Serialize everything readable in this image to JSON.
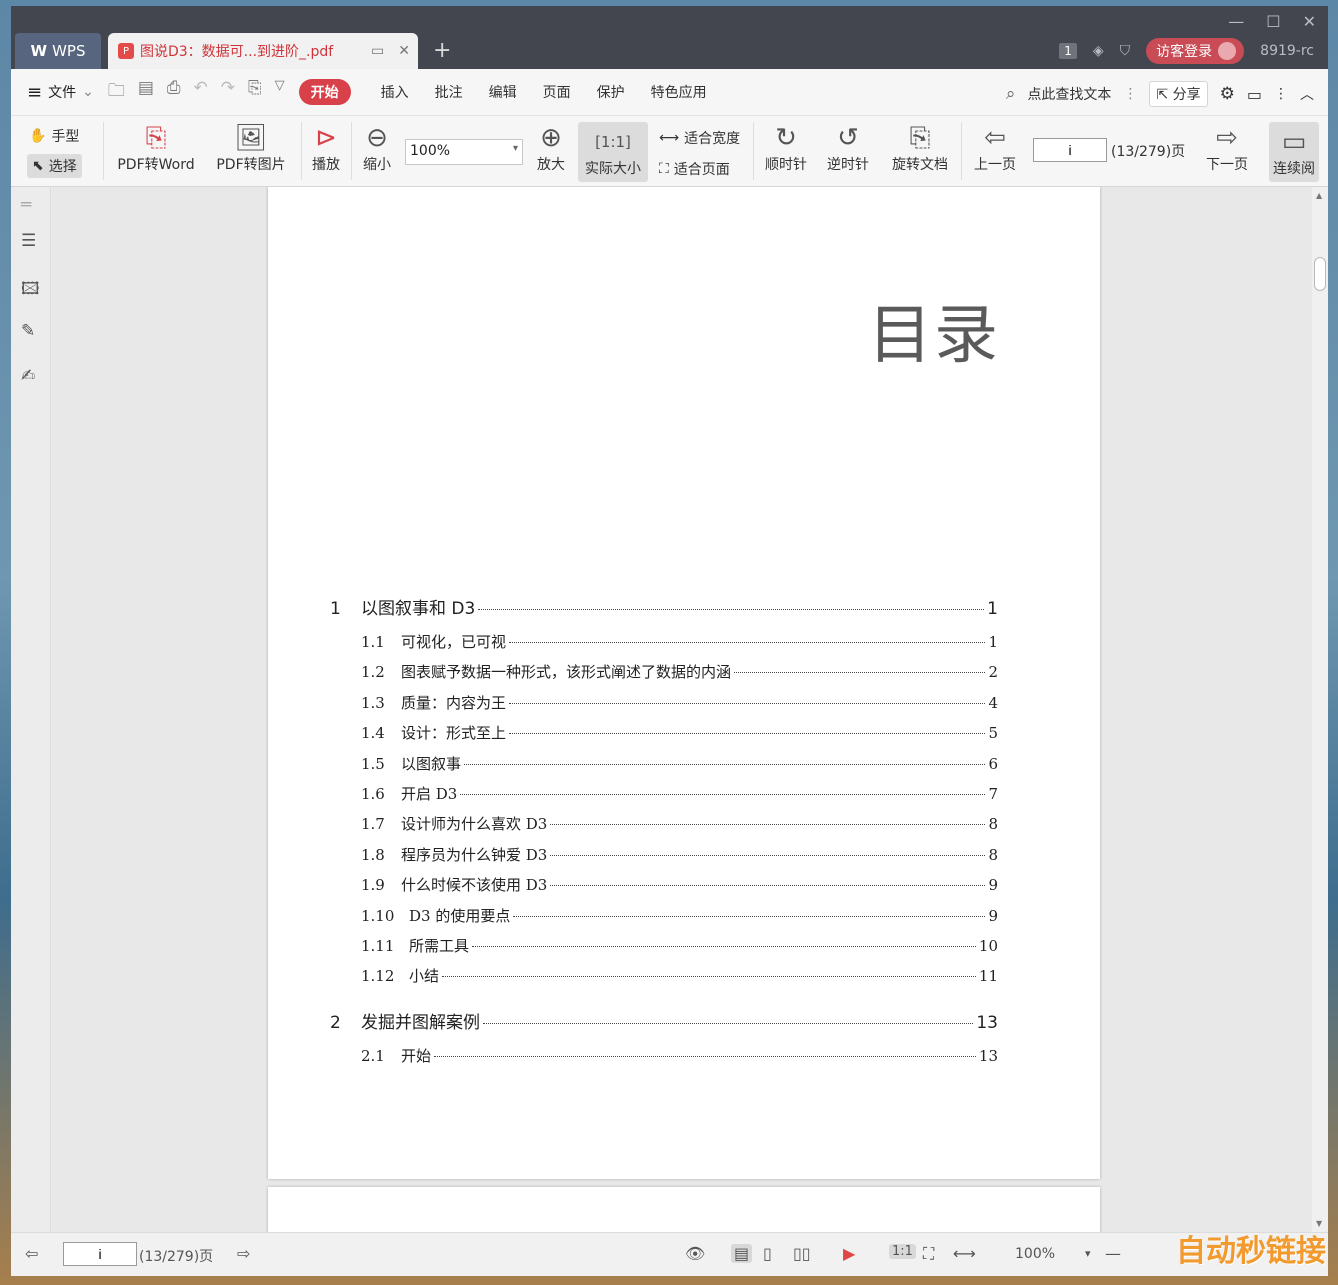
{
  "window": {
    "minimize": "—",
    "maximize": "☐",
    "close": "✕"
  },
  "tabs": {
    "wps_label": "WPS",
    "doc_title": "图说D3：数据可...到进阶_.pdf",
    "new_tab": "+"
  },
  "titlebar_right": {
    "page_badge": "1",
    "login": "访客登录",
    "user_id": "8919-rc"
  },
  "menu": {
    "file": "文件",
    "ribbon_tabs": [
      "开始",
      "插入",
      "批注",
      "编辑",
      "页面",
      "保护",
      "特色应用"
    ],
    "search": "点此查找文本",
    "share": "分享"
  },
  "toolbar": {
    "hand": "手型",
    "select": "选择",
    "pdf_to_word": "PDF转Word",
    "pdf_to_image": "PDF转图片",
    "play": "播放",
    "zoom_out": "缩小",
    "zoom_value": "100%",
    "zoom_in": "放大",
    "actual_size": "实际大小",
    "fit_width": "适合宽度",
    "fit_page": "适合页面",
    "rotate_cw": "顺时针",
    "rotate_ccw": "逆时针",
    "rotate_doc": "旋转文档",
    "prev_page": "上一页",
    "page_input": "i",
    "page_count": "(13/279)页",
    "next_page": "下一页",
    "continuous": "连续阅"
  },
  "document": {
    "heading": "目录",
    "toc": [
      {
        "type": "ch",
        "num": "1",
        "title": "以图叙事和 D3",
        "page": "1"
      },
      {
        "type": "sec",
        "num": "1.1",
        "title": "可视化，已可视",
        "page": "1"
      },
      {
        "type": "sec",
        "num": "1.2",
        "title": "图表赋予数据一种形式，该形式阐述了数据的内涵",
        "page": "2"
      },
      {
        "type": "sec",
        "num": "1.3",
        "title": "质量：内容为王",
        "page": "4"
      },
      {
        "type": "sec",
        "num": "1.4",
        "title": "设计：形式至上",
        "page": "5"
      },
      {
        "type": "sec",
        "num": "1.5",
        "title": "以图叙事",
        "page": "6"
      },
      {
        "type": "sec",
        "num": "1.6",
        "title": "开启 D3",
        "page": "7"
      },
      {
        "type": "sec",
        "num": "1.7",
        "title": "设计师为什么喜欢 D3",
        "page": "8"
      },
      {
        "type": "sec",
        "num": "1.8",
        "title": "程序员为什么钟爱 D3",
        "page": "8"
      },
      {
        "type": "sec",
        "num": "1.9",
        "title": "什么时候不该使用 D3",
        "page": "9"
      },
      {
        "type": "sec",
        "num": "1.10",
        "title": "D3 的使用要点",
        "page": "9"
      },
      {
        "type": "sec",
        "num": "1.11",
        "title": "所需工具",
        "page": "10"
      },
      {
        "type": "sec",
        "num": "1.12",
        "title": "小结",
        "page": "11"
      },
      {
        "type": "ch",
        "num": "2",
        "title": "发掘并图解案例",
        "page": "13"
      },
      {
        "type": "sec",
        "num": "2.1",
        "title": "开始",
        "page": "13"
      }
    ]
  },
  "statusbar": {
    "page_input": "i",
    "page_count": "(13/279)页",
    "zoom": "100%"
  },
  "watermark": "自动秒链接"
}
